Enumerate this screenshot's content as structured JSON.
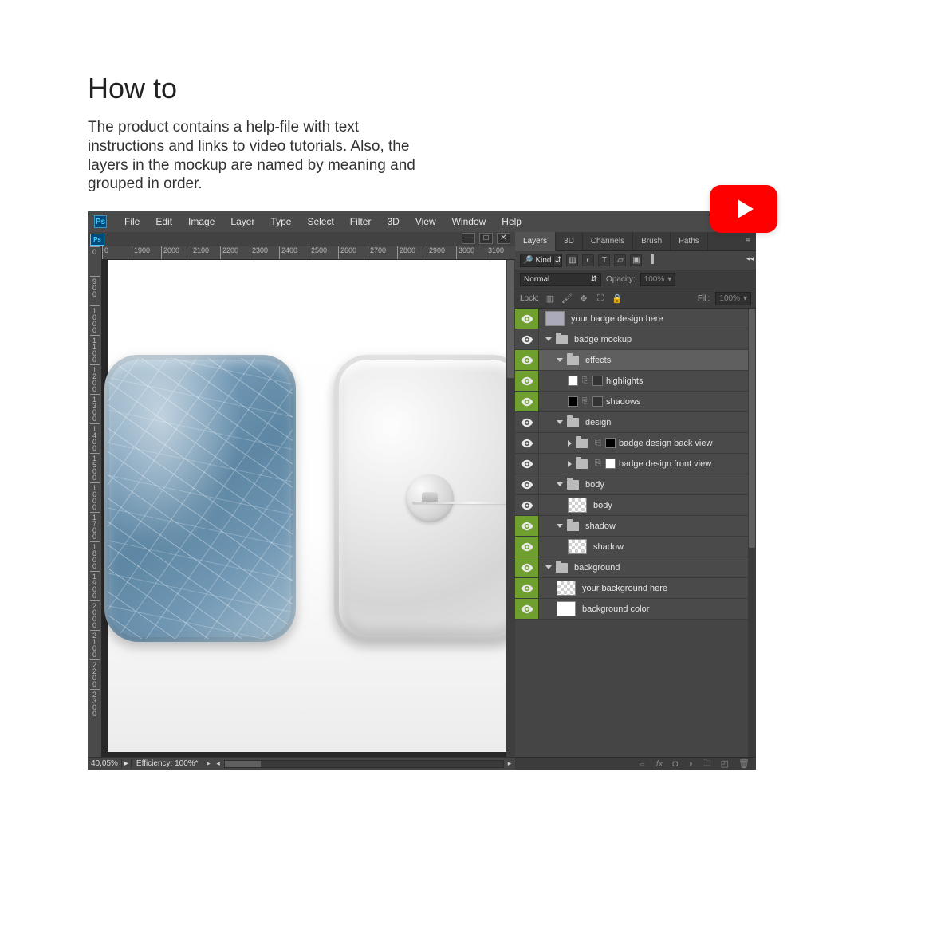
{
  "page": {
    "title": "How to",
    "description": "The product contains a help-file with text instructions and links to video tutorials. Also, the layers in the mockup are named by meaning and grouped in order."
  },
  "menuBar": {
    "logo": "Ps",
    "items": [
      "File",
      "Edit",
      "Image",
      "Layer",
      "Type",
      "Select",
      "Filter",
      "3D",
      "View",
      "Window",
      "Help"
    ]
  },
  "docTab": {
    "logo": "Ps",
    "winCtrls": [
      "—",
      "□",
      "✕"
    ]
  },
  "rulerH": [
    "0",
    "1900",
    "2000",
    "2100",
    "2200",
    "2300",
    "2400",
    "2500",
    "2600",
    "2700",
    "2800",
    "2900",
    "3000",
    "3100"
  ],
  "rulerV": [
    "0",
    "900",
    "1000",
    "1100",
    "1200",
    "1300",
    "1400",
    "1500",
    "1600",
    "1700",
    "1800",
    "1900",
    "2000",
    "2100",
    "2200",
    "2300"
  ],
  "status": {
    "zoom": "40,05%",
    "efficiency": "Efficiency: 100%*"
  },
  "panelTabs": [
    "Layers",
    "3D",
    "Channels",
    "Brush",
    "Paths"
  ],
  "filter": {
    "label": "Kind"
  },
  "blend": {
    "mode": "Normal",
    "opacityLabel": "Opacity:",
    "opacityValue": "100%",
    "lockLabel": "Lock:",
    "fillLabel": "Fill:",
    "fillValue": "100%"
  },
  "layers": [
    {
      "eye": false,
      "eyeHi": true,
      "indent": 0,
      "type": "smart",
      "name": "your badge design here"
    },
    {
      "eye": true,
      "indent": 0,
      "type": "folder-open",
      "name": "badge mockup"
    },
    {
      "eye": true,
      "eyeHi": true,
      "indent": 1,
      "type": "folder-open",
      "name": "effects",
      "sel": true
    },
    {
      "eye": true,
      "eyeHi": true,
      "indent": 2,
      "type": "mask-white",
      "name": "highlights"
    },
    {
      "eye": true,
      "eyeHi": true,
      "indent": 2,
      "type": "mask-black",
      "name": "shadows"
    },
    {
      "eye": true,
      "indent": 1,
      "type": "folder-open",
      "name": "design"
    },
    {
      "eye": true,
      "indent": 2,
      "type": "mask-closed-dark",
      "name": "badge design back view"
    },
    {
      "eye": true,
      "indent": 2,
      "type": "mask-closed-white",
      "name": "badge design front view"
    },
    {
      "eye": true,
      "indent": 1,
      "type": "folder-open",
      "name": "body"
    },
    {
      "eye": true,
      "indent": 2,
      "type": "checker",
      "name": "body"
    },
    {
      "eye": true,
      "eyeHi": true,
      "indent": 1,
      "type": "folder-open",
      "name": "shadow"
    },
    {
      "eye": true,
      "eyeHi": true,
      "indent": 2,
      "type": "checker",
      "name": "shadow"
    },
    {
      "eye": true,
      "eyeHi": true,
      "indent": 0,
      "type": "folder-open",
      "name": "background"
    },
    {
      "eye": true,
      "eyeHi": true,
      "indent": 1,
      "type": "checker",
      "name": "your background here"
    },
    {
      "eye": true,
      "eyeHi": true,
      "indent": 1,
      "type": "white",
      "name": "background color"
    }
  ]
}
